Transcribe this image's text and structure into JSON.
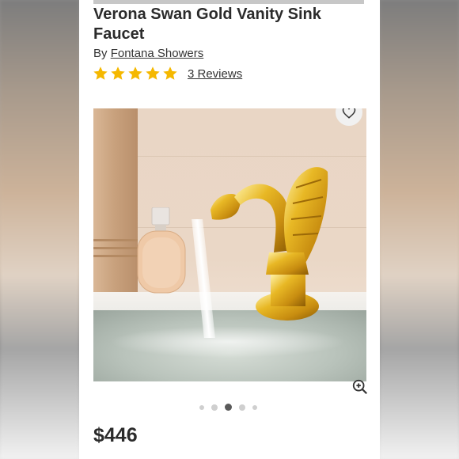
{
  "product": {
    "title": "Verona Swan Gold Vanity Sink Faucet",
    "byline_prefix": "By",
    "brand": "Fontana Showers",
    "rating_stars": 5,
    "reviews_label": "3 Reviews",
    "price": "$446"
  },
  "gallery": {
    "slide_count": 5,
    "active_slide": 3
  },
  "colors": {
    "star": "#F5B800",
    "accent_dark": "#2b2b2b",
    "dot_active": "#5a5a5a",
    "dot_inactive": "#cfcfcf"
  },
  "icons": {
    "favorite": "heart-outline-icon",
    "zoom": "zoom-in-icon"
  }
}
